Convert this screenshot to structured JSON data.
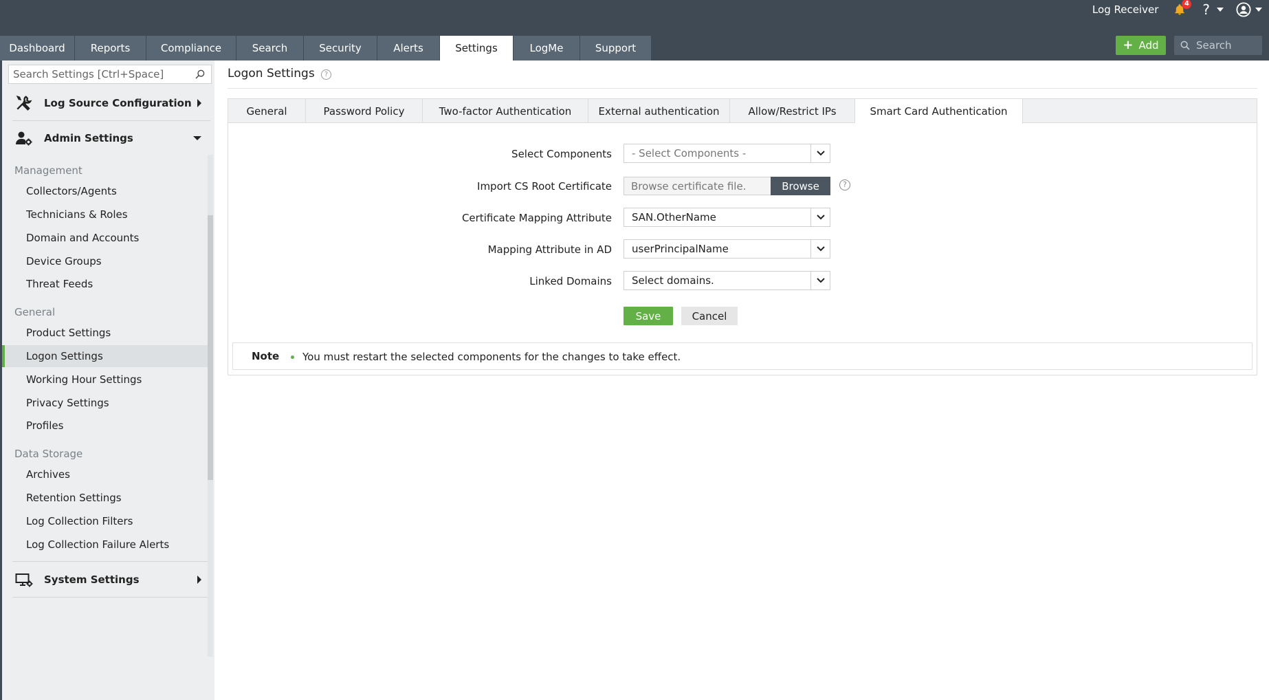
{
  "header": {
    "product_name": "Log Receiver",
    "notification_count": "4",
    "help_symbol": "?",
    "add_label": "Add",
    "search_placeholder": "Search"
  },
  "nav": {
    "tabs": [
      {
        "label": "Dashboard"
      },
      {
        "label": "Reports"
      },
      {
        "label": "Compliance"
      },
      {
        "label": "Search"
      },
      {
        "label": "Security"
      },
      {
        "label": "Alerts"
      },
      {
        "label": "Settings",
        "active": true
      },
      {
        "label": "LogMe"
      },
      {
        "label": "Support"
      }
    ]
  },
  "sidebar": {
    "search_placeholder": "Search Settings [Ctrl+Space]",
    "sections": [
      {
        "label": "Log Source Configuration",
        "icon": "tools-icon",
        "expanded": false
      },
      {
        "label": "Admin Settings",
        "icon": "user-gear-icon",
        "expanded": true
      },
      {
        "label": "System Settings",
        "icon": "monitor-gear-icon",
        "expanded": false
      }
    ],
    "groups": [
      {
        "label": "Management",
        "items": [
          "Collectors/Agents",
          "Technicians & Roles",
          "Domain and Accounts",
          "Device Groups",
          "Threat Feeds"
        ]
      },
      {
        "label": "General",
        "items": [
          "Product Settings",
          "Logon Settings",
          "Working Hour Settings",
          "Privacy Settings",
          "Profiles"
        ]
      },
      {
        "label": "Data Storage",
        "items": [
          "Archives",
          "Retention Settings",
          "Log Collection Filters",
          "Log Collection Failure Alerts"
        ]
      }
    ],
    "active_item": "Logon Settings"
  },
  "page": {
    "title": "Logon Settings",
    "help_symbol": "?",
    "subtabs": [
      {
        "label": "General"
      },
      {
        "label": "Password Policy"
      },
      {
        "label": "Two-factor Authentication"
      },
      {
        "label": "External authentication"
      },
      {
        "label": "Allow/Restrict IPs"
      },
      {
        "label": "Smart Card Authentication",
        "active": true
      }
    ]
  },
  "form": {
    "select_components": {
      "label": "Select Components",
      "value": "- Select Components -"
    },
    "import_cert": {
      "label": "Import CS Root Certificate",
      "placeholder": "Browse certificate file.",
      "browse_label": "Browse",
      "help_symbol": "?"
    },
    "cert_mapping": {
      "label": "Certificate Mapping Attribute",
      "value": "SAN.OtherName"
    },
    "ad_mapping": {
      "label": "Mapping Attribute in AD",
      "value": "userPrincipalName"
    },
    "linked_domains": {
      "label": "Linked Domains",
      "value": "Select domains."
    },
    "save_label": "Save",
    "cancel_label": "Cancel"
  },
  "note": {
    "title": "Note",
    "text": "You must restart the selected components for the changes to take effect."
  },
  "colors": {
    "header_bg": "#3f4a55",
    "tab_bg": "#596774",
    "accent_green": "#62b046",
    "sidebar_bg": "#eceeef"
  }
}
